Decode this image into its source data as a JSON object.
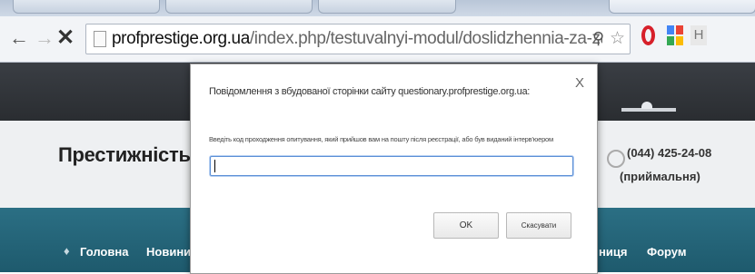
{
  "browser": {
    "url_host": "profprestige.org.ua",
    "url_path": "/index.php/testuvalnyi-modul/doslidzhennia-za-zapytom-inte",
    "icons": [
      "back-icon",
      "forward-icon",
      "stop-icon",
      "page-icon",
      "zoom-icon",
      "star-icon",
      "opera-icon",
      "extension-icon",
      "extension-h-icon"
    ],
    "ext_h_label": "H"
  },
  "page": {
    "site_title": "Престижність пр",
    "phone": "(044) 425-24-08",
    "phone_label": "(приймальня)",
    "nav": [
      "Головна",
      "Новини",
      "ниця",
      "Форум"
    ]
  },
  "dialog": {
    "title": "Повідомлення з вбудованої сторінки сайту questionary.profprestige.org.ua:",
    "message": "Введіть код проходження опитування, який прийшов вам на пошту після реєстрації, або був виданий інтерв'юером",
    "input_value": "",
    "ok_label": "OK",
    "cancel_label": "Скасувати",
    "close_label": "X"
  }
}
